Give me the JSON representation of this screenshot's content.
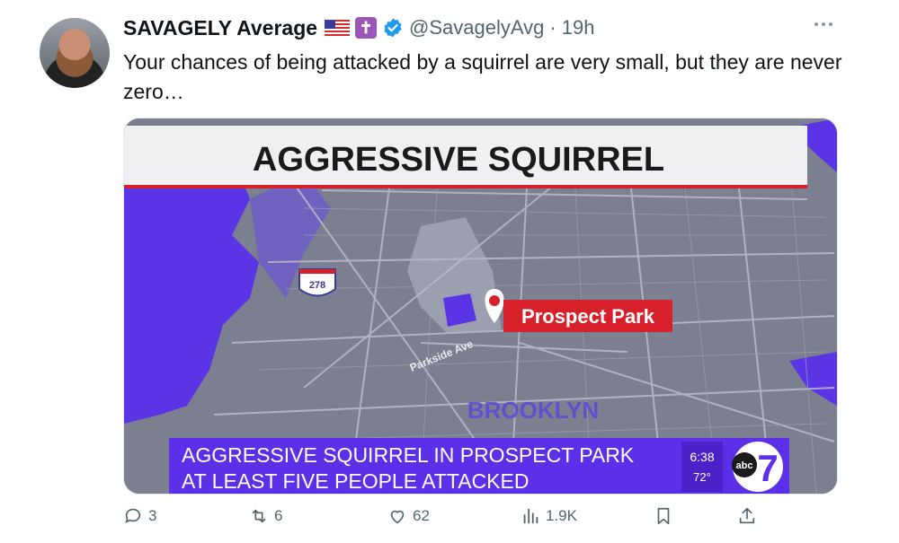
{
  "post": {
    "author_name": "SAVAGELY Average",
    "handle": "@SavagelyAvg",
    "separator": "·",
    "time": "19h",
    "text": "Your chances of being attacked by a squirrel are very small, but they are never zero…"
  },
  "media": {
    "headline": "AGGRESSIVE SQUIRREL",
    "route_shield": "278",
    "park_label": "Prospect Park",
    "street_label": "Parkside Ave",
    "borough_label": "BROOKLYN",
    "ticker_line1": "AGGRESSIVE SQUIRREL IN PROSPECT PARK",
    "ticker_line2": "AT LEAST FIVE PEOPLE ATTACKED",
    "clock": "6:38",
    "temperature": "72°",
    "network_logo": "abc",
    "channel_number": "7"
  },
  "actions": {
    "replies": "3",
    "reposts": "6",
    "likes": "62",
    "views": "1.9K"
  },
  "colors": {
    "map_water": "#5a35e6",
    "map_land": "#7c7f90",
    "headline_bar": "#f0f0f2",
    "red_accent": "#d8202a",
    "ticker": "#5b30e8",
    "verified": "#1d9bf0",
    "muted_text": "#536471"
  }
}
